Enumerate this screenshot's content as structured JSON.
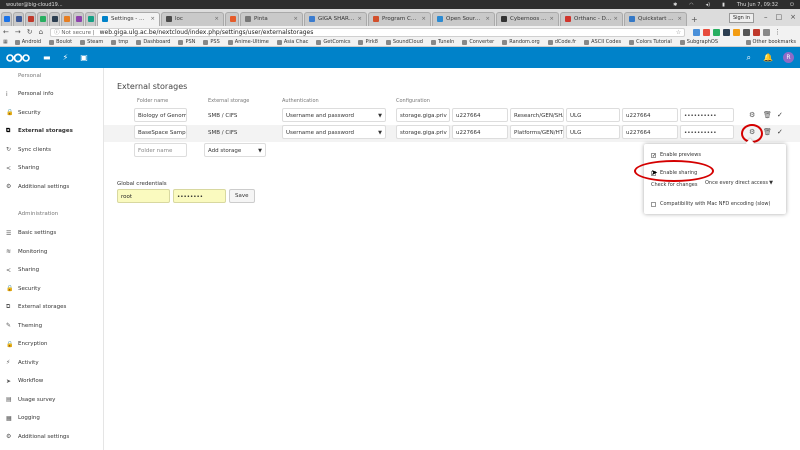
{
  "system_bar": {
    "user": "wouter@big-cloud19...",
    "datetime": "Thu Jun  7, 09:32",
    "tray_icons": [
      "bluetooth-icon",
      "wifi-icon",
      "volume-icon",
      "battery-icon",
      "power-icon"
    ]
  },
  "browser": {
    "tabs": [
      {
        "label": "Settings - Nextcloud",
        "active": true,
        "favicon_color": "#0082c9"
      },
      {
        "label": "loc",
        "active": false,
        "favicon_color": "#4a4a4a"
      },
      {
        "label": "",
        "active": false,
        "favicon_color": "#e55b2a"
      },
      {
        "label": "Pinta",
        "active": false,
        "favicon_color": "#777777"
      },
      {
        "label": "GIGA SHARE - GIGA",
        "active": false,
        "favicon_color": "#3b7ccf"
      },
      {
        "label": "Program Committee",
        "active": false,
        "favicon_color": "#d24f2b"
      },
      {
        "label": "Open Source Summit",
        "active": false,
        "favicon_color": "#2b8ad2"
      },
      {
        "label": "Cybernoos Software",
        "active": false,
        "favicon_color": "#333333"
      },
      {
        "label": "Orthanc - DICOM Serv",
        "active": false,
        "favicon_color": "#d0342c"
      },
      {
        "label": "Quickstart — Orthanc",
        "active": false,
        "favicon_color": "#3478c6"
      }
    ],
    "signin_label": "Sign in",
    "security_label": "Not secure",
    "url": "web.giga.ulg.ac.be/nextcloud/index.php/settings/user/externalstorages",
    "bookmarks": [
      "Android",
      "Boulot",
      "Steam",
      "tmp",
      "Dashboard",
      "PSN",
      "PSS",
      "Anime-Ultime",
      "Asia Chac",
      "GetComics",
      "Pirk8",
      "SoundCloud",
      "TuneIn",
      "Converter",
      "Random.org",
      "dCode.fr",
      "ASCII Codes",
      "Colors Tutorial",
      "SubgraphOS"
    ],
    "other_bookmarks": "Other bookmarks"
  },
  "header": {
    "avatar_letter": "R"
  },
  "sidebar": {
    "personal_title": "Personal",
    "personal_items": [
      {
        "label": "Personal info",
        "icon": "info-icon",
        "active": false
      },
      {
        "label": "Security",
        "icon": "lock-icon",
        "active": false
      },
      {
        "label": "External storages",
        "icon": "external-icon",
        "active": true
      },
      {
        "label": "Sync clients",
        "icon": "sync-icon",
        "active": false
      },
      {
        "label": "Sharing",
        "icon": "share-icon",
        "active": false
      },
      {
        "label": "Additional settings",
        "icon": "gear-icon",
        "active": false
      }
    ],
    "admin_title": "Administration",
    "admin_items": [
      {
        "label": "Basic settings",
        "icon": "sliders-icon"
      },
      {
        "label": "Monitoring",
        "icon": "monitor-icon"
      },
      {
        "label": "Sharing",
        "icon": "share-icon"
      },
      {
        "label": "Security",
        "icon": "lock-icon"
      },
      {
        "label": "External storages",
        "icon": "external-icon"
      },
      {
        "label": "Theming",
        "icon": "brush-icon"
      },
      {
        "label": "Encryption",
        "icon": "lock-icon"
      },
      {
        "label": "Activity",
        "icon": "bolt-icon"
      },
      {
        "label": "Workflow",
        "icon": "workflow-icon"
      },
      {
        "label": "Usage survey",
        "icon": "chart-icon"
      },
      {
        "label": "Logging",
        "icon": "log-icon"
      },
      {
        "label": "Additional settings",
        "icon": "gear-icon"
      }
    ]
  },
  "main": {
    "title": "External storages",
    "columns": {
      "folder": "Folder name",
      "storage": "External storage",
      "auth": "Authentication",
      "config": "Configuration"
    },
    "rows": [
      {
        "folder": "Biology of Genome",
        "storage": "SMB / CIFS",
        "auth": "Username and password",
        "host": "storage.giga.priv",
        "user": "u227664",
        "share": "Research/GEN/SHA",
        "domain": "ULG",
        "user2": "u227664",
        "password": "••••••••••"
      },
      {
        "folder": "BaseSpace Sample",
        "storage": "SMB / CIFS",
        "auth": "Username and password",
        "host": "storage.giga.priv",
        "user": "u227664",
        "share": "Platforms/GEN/HT",
        "domain": "ULG",
        "user2": "u227664",
        "password": "••••••••••"
      }
    ],
    "new_folder_placeholder": "Folder name",
    "add_storage": "Add storage",
    "global_credentials_label": "Global credentials",
    "global_user": "root",
    "global_password": "••••••••",
    "save_label": "Save"
  },
  "popover": {
    "enable_previews": "Enable previews",
    "enable_sharing": "Enable sharing",
    "check_for_changes": "Check for changes",
    "check_option": "Once every direct access",
    "compat": "Compatibility with Mac NFD encoding (slow)"
  },
  "colors": {
    "header_blue": "#0082c9",
    "highlight_red": "#d40000",
    "credential_yellow": "#fafabf"
  }
}
